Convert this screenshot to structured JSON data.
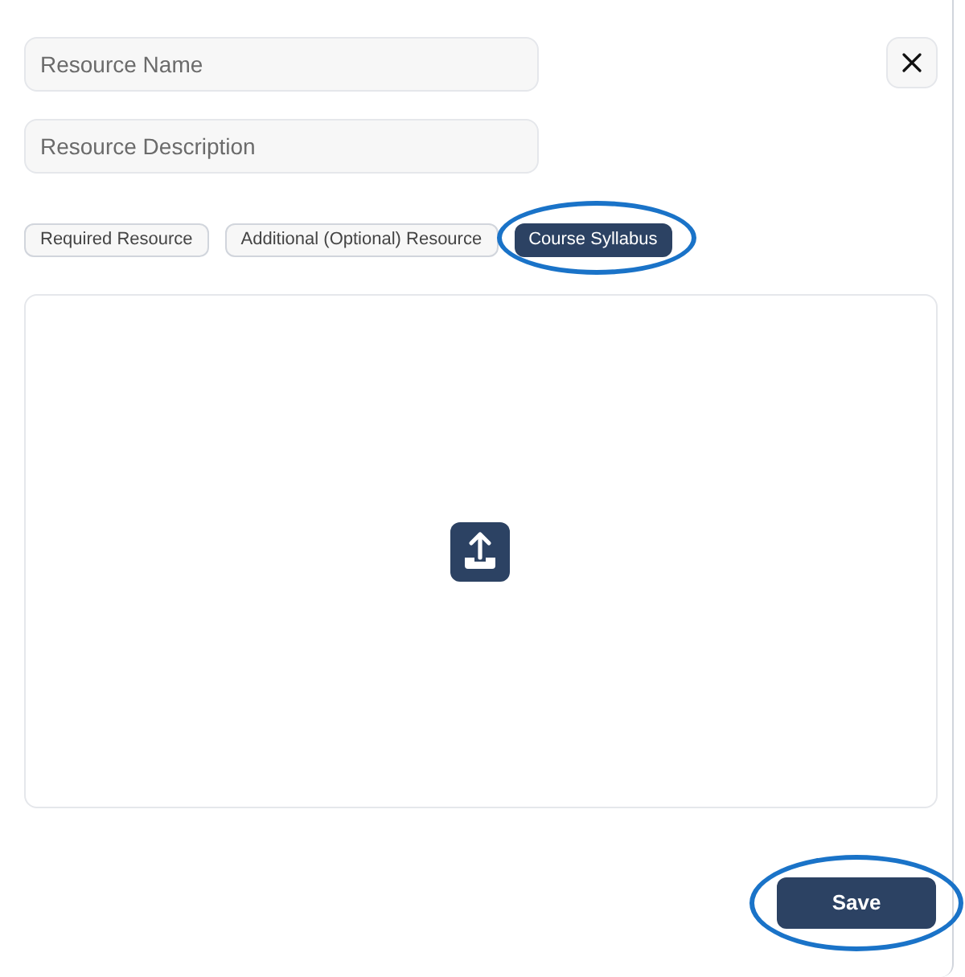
{
  "fields": [
    {
      "placeholder": "Resource Name"
    },
    {
      "placeholder": "Resource Description"
    }
  ],
  "tabs": [
    {
      "label": "Required Resource",
      "selected": false,
      "circled": false
    },
    {
      "label": "Additional (Optional) Resource",
      "selected": false,
      "circled": false
    },
    {
      "label": "Course Syllabus",
      "selected": true,
      "circled": true
    }
  ],
  "save_button": {
    "label": "Save",
    "circled": true
  }
}
